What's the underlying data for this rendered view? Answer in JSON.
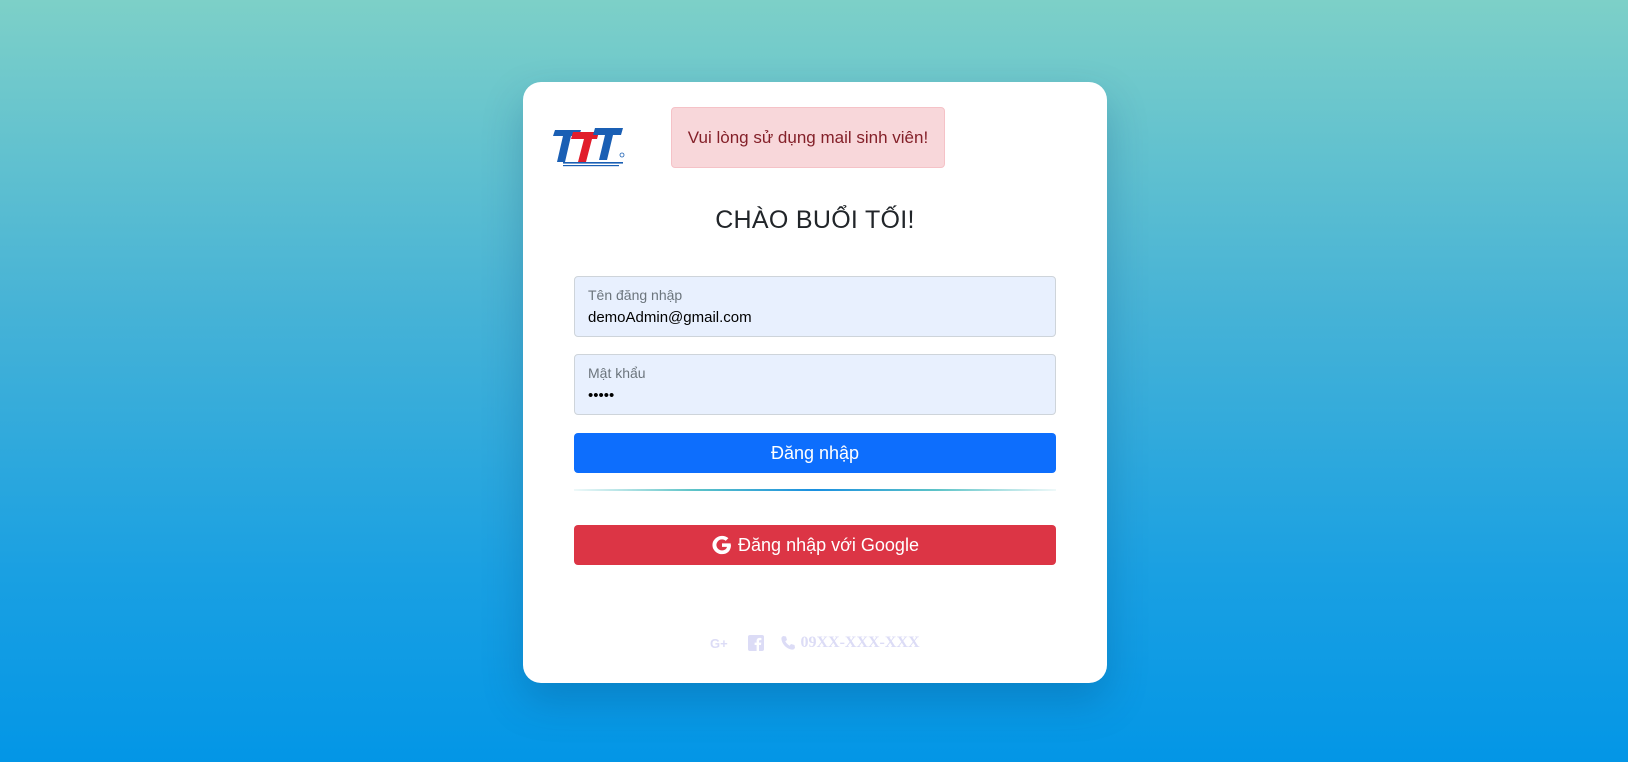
{
  "alert": {
    "text": "Vui lòng sử dụng mail sinh viên!"
  },
  "greeting": "CHÀO BUỔI TỐI!",
  "username": {
    "label": "Tên đăng nhập",
    "value": "demoAdmin@gmail.com"
  },
  "password": {
    "label": "Mật khẩu",
    "value": "•••••"
  },
  "login_button": "Đăng nhập",
  "google_button": "Đăng nhập với Google",
  "footer": {
    "icons": [
      "google-plus-icon",
      "facebook-icon",
      "phone-icon"
    ],
    "phone": "09XX-XXX-XXX"
  },
  "colors": {
    "primary": "#0d6efd",
    "danger": "#dc3545",
    "alert_bg": "#f8d7da",
    "alert_text": "#842029",
    "input_bg": "#e8f0fe"
  }
}
